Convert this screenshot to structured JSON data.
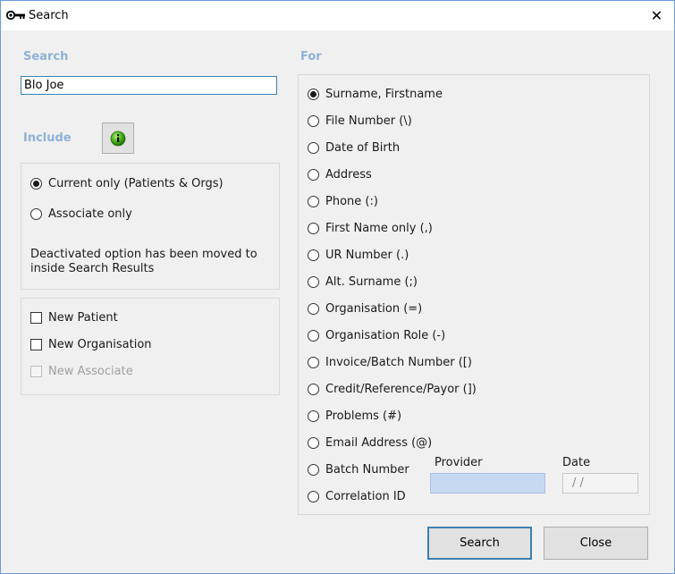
{
  "window": {
    "title": "Search",
    "close_glyph": "✕",
    "icon": "key-icon"
  },
  "search": {
    "label": "Search",
    "value": "Blo Joe"
  },
  "include": {
    "label": "Include",
    "info_icon": "info-icon",
    "options": [
      "Current only (Patients & Orgs)",
      "Associate only"
    ],
    "selected": 0,
    "note": "Deactivated option has been moved to inside Search Results"
  },
  "new_items": [
    "New Patient",
    "New Organisation",
    "New Associate"
  ],
  "for": {
    "label": "For",
    "options": [
      "Surname, Firstname",
      "File Number (\\)",
      "Date of Birth",
      "Address",
      "Phone (:)",
      "First Name only (,)",
      "UR Number (.)",
      "Alt. Surname (;)",
      "Organisation (=)",
      "Organisation Role (-)",
      "Invoice/Batch Number ([)",
      "Credit/Reference/Payor (])",
      "Problems (#)",
      "Email Address (@)",
      "Batch Number",
      "Correlation ID"
    ],
    "selected": 0
  },
  "batch": {
    "provider_label": "Provider",
    "date_label": "Date",
    "date_placeholder": "/  /"
  },
  "buttons": {
    "search": "Search",
    "close": "Close"
  },
  "colors": {
    "accent": "#3c7fb1",
    "section_label": "#8fb1d9",
    "provider_field": "#c7d9f1",
    "window_border": "#6b9bd8"
  }
}
